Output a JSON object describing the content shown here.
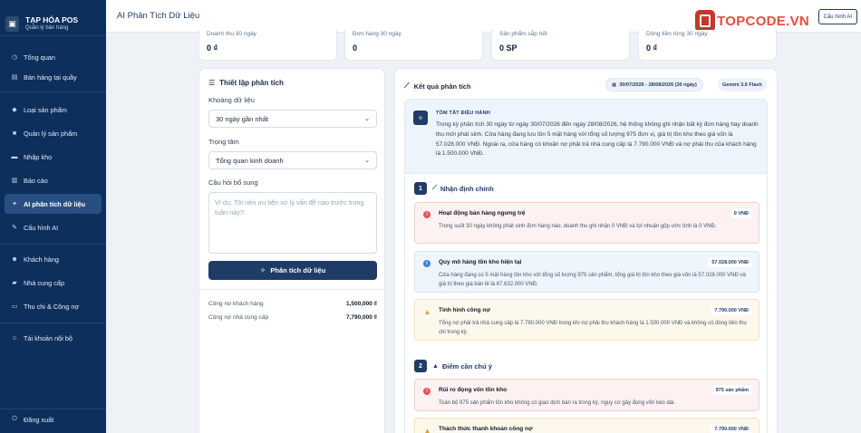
{
  "brand": {
    "title": "TẠP HÓA POS",
    "subtitle": "Quản lý bán hàng",
    "icon": "store-icon"
  },
  "sidebar": {
    "items": [
      {
        "label": "Tổng quan",
        "icon": "dashboard-icon"
      },
      {
        "label": "Bán hàng tại quầy",
        "icon": "cart-icon"
      },
      {
        "label": "Loại sản phẩm",
        "icon": "tag-icon"
      },
      {
        "label": "Quản lý sản phẩm",
        "icon": "box-icon"
      },
      {
        "label": "Nhập kho",
        "icon": "truck-icon"
      },
      {
        "label": "Báo cáo",
        "icon": "chart-icon"
      },
      {
        "label": "AI phân tích dữ liệu",
        "icon": "sparkle-icon",
        "active": true
      },
      {
        "label": "Cấu hình AI",
        "icon": "wrench-icon"
      },
      {
        "label": "Khách hàng",
        "icon": "users-icon"
      },
      {
        "label": "Nhà cung cấp",
        "icon": "supplier-icon"
      },
      {
        "label": "Thu chi & Công nợ",
        "icon": "money-icon"
      },
      {
        "label": "Tài khoản nội bộ",
        "icon": "account-icon"
      }
    ],
    "logout": "Đăng xuất"
  },
  "header": {
    "title": "AI Phân Tích Dữ Liệu",
    "config_button": "Cấu hình AI"
  },
  "watermark": {
    "logo_text": "TOPCODE.VN"
  },
  "stats": [
    {
      "label": "Doanh thu 30 ngày",
      "value": "0 ₫"
    },
    {
      "label": "Đơn hàng 30 ngày",
      "value": "0"
    },
    {
      "label": "Sản phẩm sắp hết",
      "value": "0 SP"
    },
    {
      "label": "Dòng tiền ròng 30 ngày",
      "value": "0 ₫"
    }
  ],
  "settings": {
    "title": "Thiết lập phân tích",
    "range_label": "Khoảng dữ liệu",
    "range_value": "30 ngày gần nhất",
    "focus_label": "Trọng tâm",
    "focus_value": "Tổng quan kinh doanh",
    "question_label": "Câu hỏi bổ sung",
    "question_placeholder": "Ví dụ: Tôi nên ưu tiên xử lý vấn đề nào trước trong tuần này?",
    "analyze_button": "Phân tích dữ liệu",
    "customer_debt_label": "Công nợ khách hàng",
    "customer_debt_value": "1,500,000 ₫",
    "supplier_debt_label": "Công nợ nhà cung cấp",
    "supplier_debt_value": "7,790,000 ₫"
  },
  "results": {
    "title": "Kết quả phân tích",
    "date_range": "30/07/2026 - 28/08/2026 (30 ngày)",
    "model": "Gemini 3.6 Flash",
    "exec_title": "TÓM TẮT ĐIỀU HÀNH",
    "exec_text": "Trong kỳ phân tích 30 ngày từ ngày 30/07/2026 đến ngày 28/08/2026, hệ thống không ghi nhận bất kỳ đơn hàng hay doanh thu mới phát sinh. Cửa hàng đang lưu tồn 5 mặt hàng với tổng số lượng 975 đơn vị, giá trị tồn kho theo giá vốn là 57.028.000 VNĐ. Ngoài ra, cửa hàng có khoản nợ phải trả nhà cung cấp là 7.790.000 VNĐ và nợ phải thu của khách hàng là 1.500.000 VNĐ.",
    "section1": {
      "number": "1",
      "title": "Nhận định chính"
    },
    "section2": {
      "number": "2",
      "title": "Điểm cần chú ý"
    },
    "cards1": [
      {
        "title": "Hoạt động bán hàng ngưng trệ",
        "badge": "0 VNĐ",
        "text": "Trong suốt 30 ngày không phát sinh đơn hàng nào, doanh thu ghi nhận 0 VNĐ và lợi nhuận gộp ước tính là 0 VNĐ."
      },
      {
        "title": "Quy mô hàng tồn kho hiện tại",
        "badge": "57.028.000 VNĐ",
        "text": "Cửa hàng đang có 5 mặt hàng tồn kho với tổng số lượng 975 sản phẩm, tổng giá trị tồn kho theo giá vốn là 57.028.000 VNĐ và giá trị theo giá bán lẻ là 67.632.000 VNĐ."
      },
      {
        "title": "Tình hình công nợ",
        "badge": "7.790.000 VNĐ",
        "text": "Tổng nợ phải trả nhà cung cấp là 7.790.000 VNĐ trong khi nợ phải thu khách hàng là 1.500.000 VNĐ và không có dòng tiền thu chi trong kỳ."
      }
    ],
    "cards2": [
      {
        "title": "Rủi ro đọng vốn tồn kho",
        "badge": "975 sản phẩm",
        "text": "Toàn bộ 975 sản phẩm tồn kho không có giao dịch bán ra trong kỳ, nguy cơ gây đọng vốn kéo dài."
      },
      {
        "title": "Thách thức thanh khoản công nợ",
        "badge": "7.790.000 VNĐ",
        "text": ""
      }
    ]
  }
}
